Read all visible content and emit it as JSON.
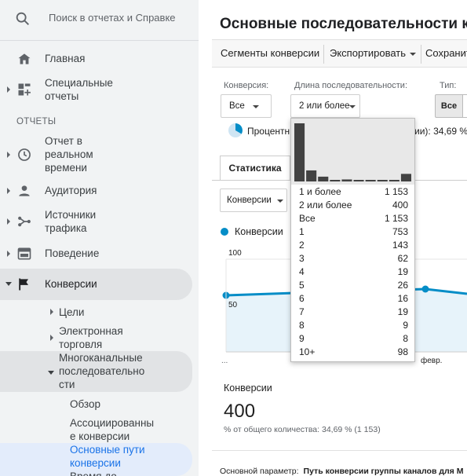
{
  "search": {
    "placeholder": "Поиск в отчетах и Справке"
  },
  "sidebar": {
    "home": "Главная",
    "custom_reports": [
      "Специальные",
      "отчеты"
    ],
    "section": "ОТЧЕТЫ",
    "realtime": [
      "Отчет в",
      "реальном",
      "времени"
    ],
    "audience": "Аудитория",
    "acquisition": [
      "Источники",
      "трафика"
    ],
    "behavior": "Поведение",
    "conversions": "Конверсии",
    "sub": {
      "goals": "Цели",
      "ecommerce": [
        "Электронная",
        "торговля"
      ],
      "multichannel": [
        "Многоканальные",
        "последовательно",
        "сти"
      ],
      "overview": "Обзор",
      "assisted": [
        "Ассоциированны",
        "е конверсии"
      ],
      "top_paths": [
        "Основные пути",
        "конверсии"
      ],
      "time_lag": "Время до"
    }
  },
  "main": {
    "title": "Основные последовательности конверсии",
    "toolbar": {
      "segments": "Сегменты конверсии",
      "export": "Экспортировать",
      "save": "Сохранить"
    },
    "filters": {
      "conversion_label": "Конверсия:",
      "conversion_value": "Все",
      "length_label": "Длина последовательности:",
      "length_value": "2 или более",
      "type_label": "Тип:",
      "type_value": "Все"
    },
    "percent_text": "Процентн",
    "percent_right": "ии): 34,69 %",
    "tab": "Статистика",
    "metric_select": "Конверсии",
    "legend": "Конверсии",
    "y_ticks": [
      "100",
      "50"
    ],
    "x_labels": [
      "...",
      "февр."
    ],
    "summary": {
      "title": "Конверсии",
      "value": "400",
      "subtitle": "% от общего количества: 34,69 % (1 153)"
    },
    "bottom": {
      "label": "Основной параметр:",
      "value": "Путь конверсии группы каналов для М"
    }
  },
  "popup": {
    "options": [
      {
        "label": "1 и более",
        "value": "1 153"
      },
      {
        "label": "2 или более",
        "value": "400"
      },
      {
        "label": "Все",
        "value": "1 153"
      },
      {
        "label": "1",
        "value": "753"
      },
      {
        "label": "2",
        "value": "143"
      },
      {
        "label": "3",
        "value": "62"
      },
      {
        "label": "4",
        "value": "19"
      },
      {
        "label": "5",
        "value": "26"
      },
      {
        "label": "6",
        "value": "16"
      },
      {
        "label": "7",
        "value": "19"
      },
      {
        "label": "8",
        "value": "9"
      },
      {
        "label": "9",
        "value": "8"
      },
      {
        "label": "10+",
        "value": "98"
      }
    ],
    "histogram": [
      753,
      143,
      62,
      19,
      26,
      16,
      19,
      9,
      8,
      98
    ]
  },
  "colors": {
    "accent": "#058dc7",
    "active_link": "#1a73e8",
    "sidebar_bg": "#f1f3f4",
    "hist_bar": "#424242"
  }
}
